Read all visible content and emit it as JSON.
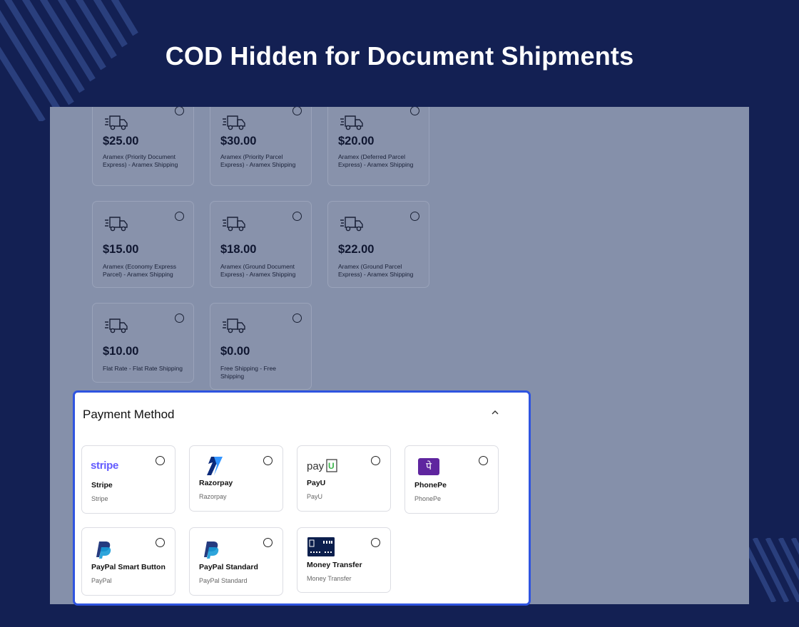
{
  "hero": {
    "title": "COD Hidden for Document Shipments"
  },
  "shipping": {
    "options": [
      {
        "price": "$25.00",
        "label": "Aramex (Priority Document Express) - Aramex Shipping"
      },
      {
        "price": "$30.00",
        "label": "Aramex (Priority Parcel Express) - Aramex Shipping"
      },
      {
        "price": "$20.00",
        "label": "Aramex (Deferred Parcel Express) - Aramex Shipping"
      },
      {
        "price": "$15.00",
        "label": "Aramex (Economy Express Parcel) - Aramex Shipping"
      },
      {
        "price": "$18.00",
        "label": "Aramex (Ground Document Express) - Aramex Shipping"
      },
      {
        "price": "$22.00",
        "label": "Aramex (Ground Parcel Express) - Aramex Shipping"
      },
      {
        "price": "$10.00",
        "label": "Flat Rate - Flat Rate Shipping"
      },
      {
        "price": "$0.00",
        "label": "Free Shipping - Free Shipping"
      }
    ]
  },
  "payment": {
    "title": "Payment Method",
    "methods": [
      {
        "name": "Stripe",
        "sub": "Stripe",
        "logo_text": "stripe",
        "icon": "stripe-logo-icon"
      },
      {
        "name": "Razorpay",
        "sub": "Razorpay",
        "icon": "razorpay-logo-icon"
      },
      {
        "name": "PayU",
        "sub": "PayU",
        "logo_text": "payu",
        "icon": "payu-logo-icon"
      },
      {
        "name": "PhonePe",
        "sub": "PhonePe",
        "logo_text": "पे",
        "icon": "phonepe-logo-icon"
      },
      {
        "name": "PayPal Smart Button",
        "sub": "PayPal",
        "icon": "paypal-logo-icon"
      },
      {
        "name": "PayPal Standard",
        "sub": "PayPal Standard",
        "icon": "paypal-logo-icon"
      },
      {
        "name": "Money Transfer",
        "sub": "Money Transfer",
        "icon": "bank-card-icon"
      }
    ]
  },
  "colors": {
    "background": "#132053",
    "overlay": "#8590aa",
    "panel_border": "#2f54e0",
    "stripe_brand": "#635bff",
    "phonepe_brand": "#5f259f",
    "paypal_dark": "#253b80",
    "paypal_light": "#179bd7"
  }
}
